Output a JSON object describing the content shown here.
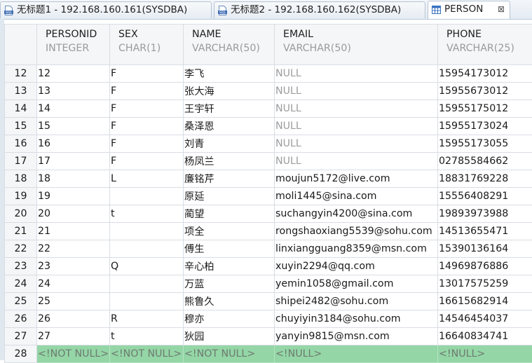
{
  "tabs": [
    {
      "label": "无标题1 - 192.168.160.161(SYSDBA)",
      "icon": "sql-file-icon",
      "active": false
    },
    {
      "label": "无标题2 - 192.168.160.162(SYSDBA)",
      "icon": "sql-file-icon",
      "active": false
    },
    {
      "label": "PERSON",
      "icon": "table-grid-icon",
      "active": true,
      "close": "⊠"
    }
  ],
  "columns": [
    {
      "name": "PERSONID",
      "type": "INTEGER"
    },
    {
      "name": "SEX",
      "type": "CHAR(1)"
    },
    {
      "name": "NAME",
      "type": "VARCHAR(50)"
    },
    {
      "name": "EMAIL",
      "type": "VARCHAR(50)"
    },
    {
      "name": "PHONE",
      "type": "VARCHAR(25)"
    }
  ],
  "rows": [
    {
      "n": "12",
      "cells": [
        "12",
        "F",
        "李飞",
        "NULL",
        "15954173012"
      ]
    },
    {
      "n": "13",
      "cells": [
        "13",
        "F",
        "张大海",
        "NULL",
        "15955673012"
      ]
    },
    {
      "n": "14",
      "cells": [
        "14",
        "F",
        "王宇轩",
        "NULL",
        "15955175012"
      ]
    },
    {
      "n": "15",
      "cells": [
        "15",
        "F",
        "桑泽恩",
        "NULL",
        "15955173024"
      ]
    },
    {
      "n": "16",
      "cells": [
        "16",
        "F",
        "刘青",
        "NULL",
        "15955173055"
      ]
    },
    {
      "n": "17",
      "cells": [
        "17",
        "F",
        "杨凤兰",
        "NULL",
        "02785584662"
      ]
    },
    {
      "n": "18",
      "cells": [
        "18",
        "L",
        "廉铭芹",
        "moujun5172@live.com",
        "18831769228"
      ]
    },
    {
      "n": "19",
      "cells": [
        "19",
        "",
        "原延",
        "moli1445@sina.com",
        "15556408291"
      ]
    },
    {
      "n": "20",
      "cells": [
        "20",
        "t",
        "蔺望",
        "suchangyin4200@sina.com",
        "19893973988"
      ]
    },
    {
      "n": "21",
      "cells": [
        "21",
        "",
        "项全",
        "rongshaoxiang5539@sohu.com",
        "14513655471"
      ]
    },
    {
      "n": "22",
      "cells": [
        "22",
        "",
        "傅生",
        "linxiangguang8359@msn.com",
        "15390136164"
      ]
    },
    {
      "n": "23",
      "cells": [
        "23",
        "Q",
        "辛心柏",
        "xuyin2294@qq.com",
        "14969876886"
      ]
    },
    {
      "n": "24",
      "cells": [
        "24",
        "",
        "万蓝",
        "yemin1058@gmail.com",
        "13017575259"
      ]
    },
    {
      "n": "25",
      "cells": [
        "25",
        "",
        "熊鲁久",
        "shipei2482@sohu.com",
        "16615682914"
      ]
    },
    {
      "n": "26",
      "cells": [
        "26",
        "R",
        "穆亦",
        "chuyiyin3184@sohu.com",
        "14546454037"
      ]
    },
    {
      "n": "27",
      "cells": [
        "27",
        "t",
        "狄园",
        "yanyin9815@msn.com",
        "16640834741"
      ]
    }
  ],
  "new_row": {
    "n": "28",
    "cells": [
      "<!NOT NULL>",
      "<!NOT NULL>",
      "<!NOT NULL>",
      "<!NULL>",
      "<!NULL>"
    ]
  },
  "colors": {
    "new_row_bg": "#94d6a6",
    "null_text": "#9c9c9c",
    "header_type": "#9a9a9a"
  }
}
